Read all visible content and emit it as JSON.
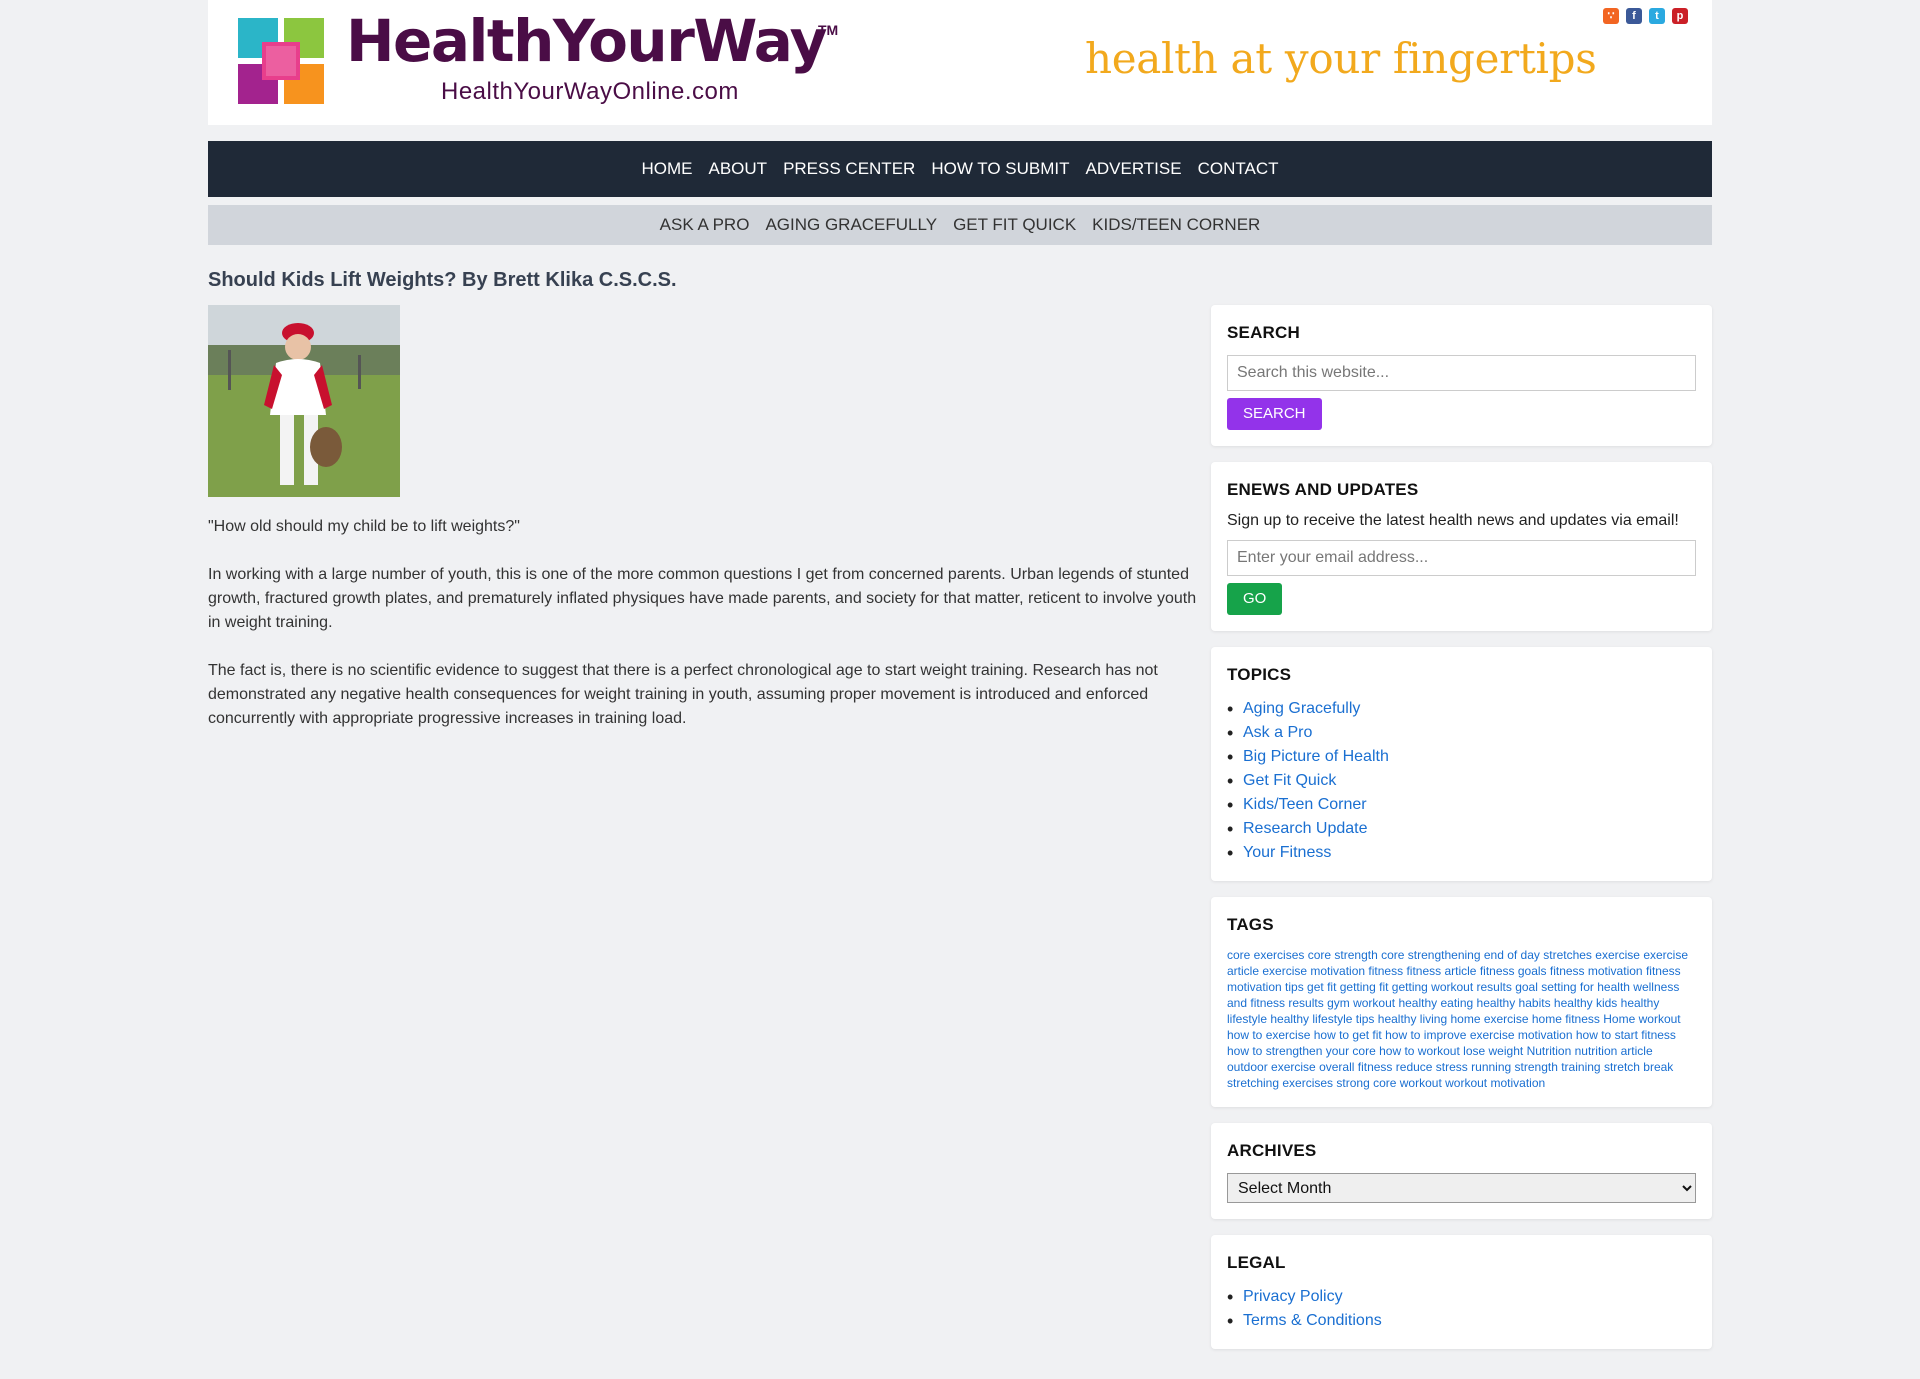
{
  "brand": {
    "name": "HealthYourWay",
    "tm": "TM",
    "url": "HealthYourWayOnline.com",
    "tagline": "health at your fingertips",
    "colors": {
      "purple": "#4a0d46",
      "gold": "#f2a91d",
      "navy": "#1f2937"
    }
  },
  "social": [
    {
      "name": "rss-icon",
      "glyph": "∵",
      "color": "#f26522"
    },
    {
      "name": "facebook-icon",
      "glyph": "f",
      "color": "#3b5998"
    },
    {
      "name": "twitter-icon",
      "glyph": "t",
      "color": "#2aa9e0"
    },
    {
      "name": "pinterest-icon",
      "glyph": "p",
      "color": "#cb2027"
    }
  ],
  "nav_primary": [
    "HOME",
    "ABOUT",
    "PRESS CENTER",
    "HOW TO SUBMIT",
    "ADVERTISE",
    "CONTACT"
  ],
  "nav_secondary": [
    "ASK A PRO",
    "AGING GRACEFULLY",
    "GET FIT QUICK",
    "KIDS/TEEN CORNER"
  ],
  "post": {
    "title": "Should Kids Lift Weights? By Brett Klika C.S.C.S.",
    "paragraphs": [
      "\"How old should my child be to lift weights?\"",
      "In working with a large number of youth, this is one of the more common questions I get from concerned parents. Urban legends of stunted growth, fractured growth plates, and prematurely inflated physiques have made parents, and society for that matter, reticent to involve youth in weight training.",
      "The fact is, there is no scientific evidence to suggest that there is a perfect chronological age to start weight training. Research has not demonstrated any negative health consequences for weight training in youth, assuming proper movement is introduced and enforced concurrently with appropriate progressive increases in training load."
    ]
  },
  "sidebar": {
    "search": {
      "title": "SEARCH",
      "placeholder": "Search this website...",
      "button": "SEARCH"
    },
    "enews": {
      "title": "ENEWS AND UPDATES",
      "lead": "Sign up to receive the latest health news and updates via email!",
      "placeholder": "Enter your email address...",
      "button": "GO"
    },
    "topics": {
      "title": "TOPICS",
      "items": [
        "Aging Gracefully",
        "Ask a Pro",
        "Big Picture of Health",
        "Get Fit Quick",
        "Kids/Teen Corner",
        "Research Update",
        "Your Fitness"
      ]
    },
    "tags": {
      "title": "TAGS",
      "items": [
        "core exercises",
        "core strength",
        "core strengthening",
        "end of day stretches",
        "exercise",
        "exercise article",
        "exercise motivation",
        "fitness",
        "fitness article",
        "fitness goals",
        "fitness motivation",
        "fitness motivation tips",
        "get fit",
        "getting fit",
        "getting workout results",
        "goal setting for health",
        "wellness and fitness results",
        "gym workout",
        "healthy eating",
        "healthy habits",
        "healthy kids",
        "healthy lifestyle",
        "healthy lifestyle tips",
        "healthy living",
        "home exercise",
        "home fitness",
        "Home workout",
        "how to exercise",
        "how to get fit",
        "how to improve exercise motivation",
        "how to start fitness",
        "how to strengthen your core",
        "how to workout",
        "lose weight",
        "Nutrition",
        "nutrition article",
        "outdoor exercise",
        "overall fitness",
        "reduce stress",
        "running",
        "strength training",
        "stretch break",
        "stretching exercises",
        "strong core workout",
        "workout motivation"
      ]
    },
    "archives": {
      "title": "ARCHIVES",
      "selected": "Select Month"
    },
    "legal": {
      "title": "LEGAL",
      "items": [
        "Privacy Policy",
        "Terms & Conditions"
      ]
    }
  }
}
